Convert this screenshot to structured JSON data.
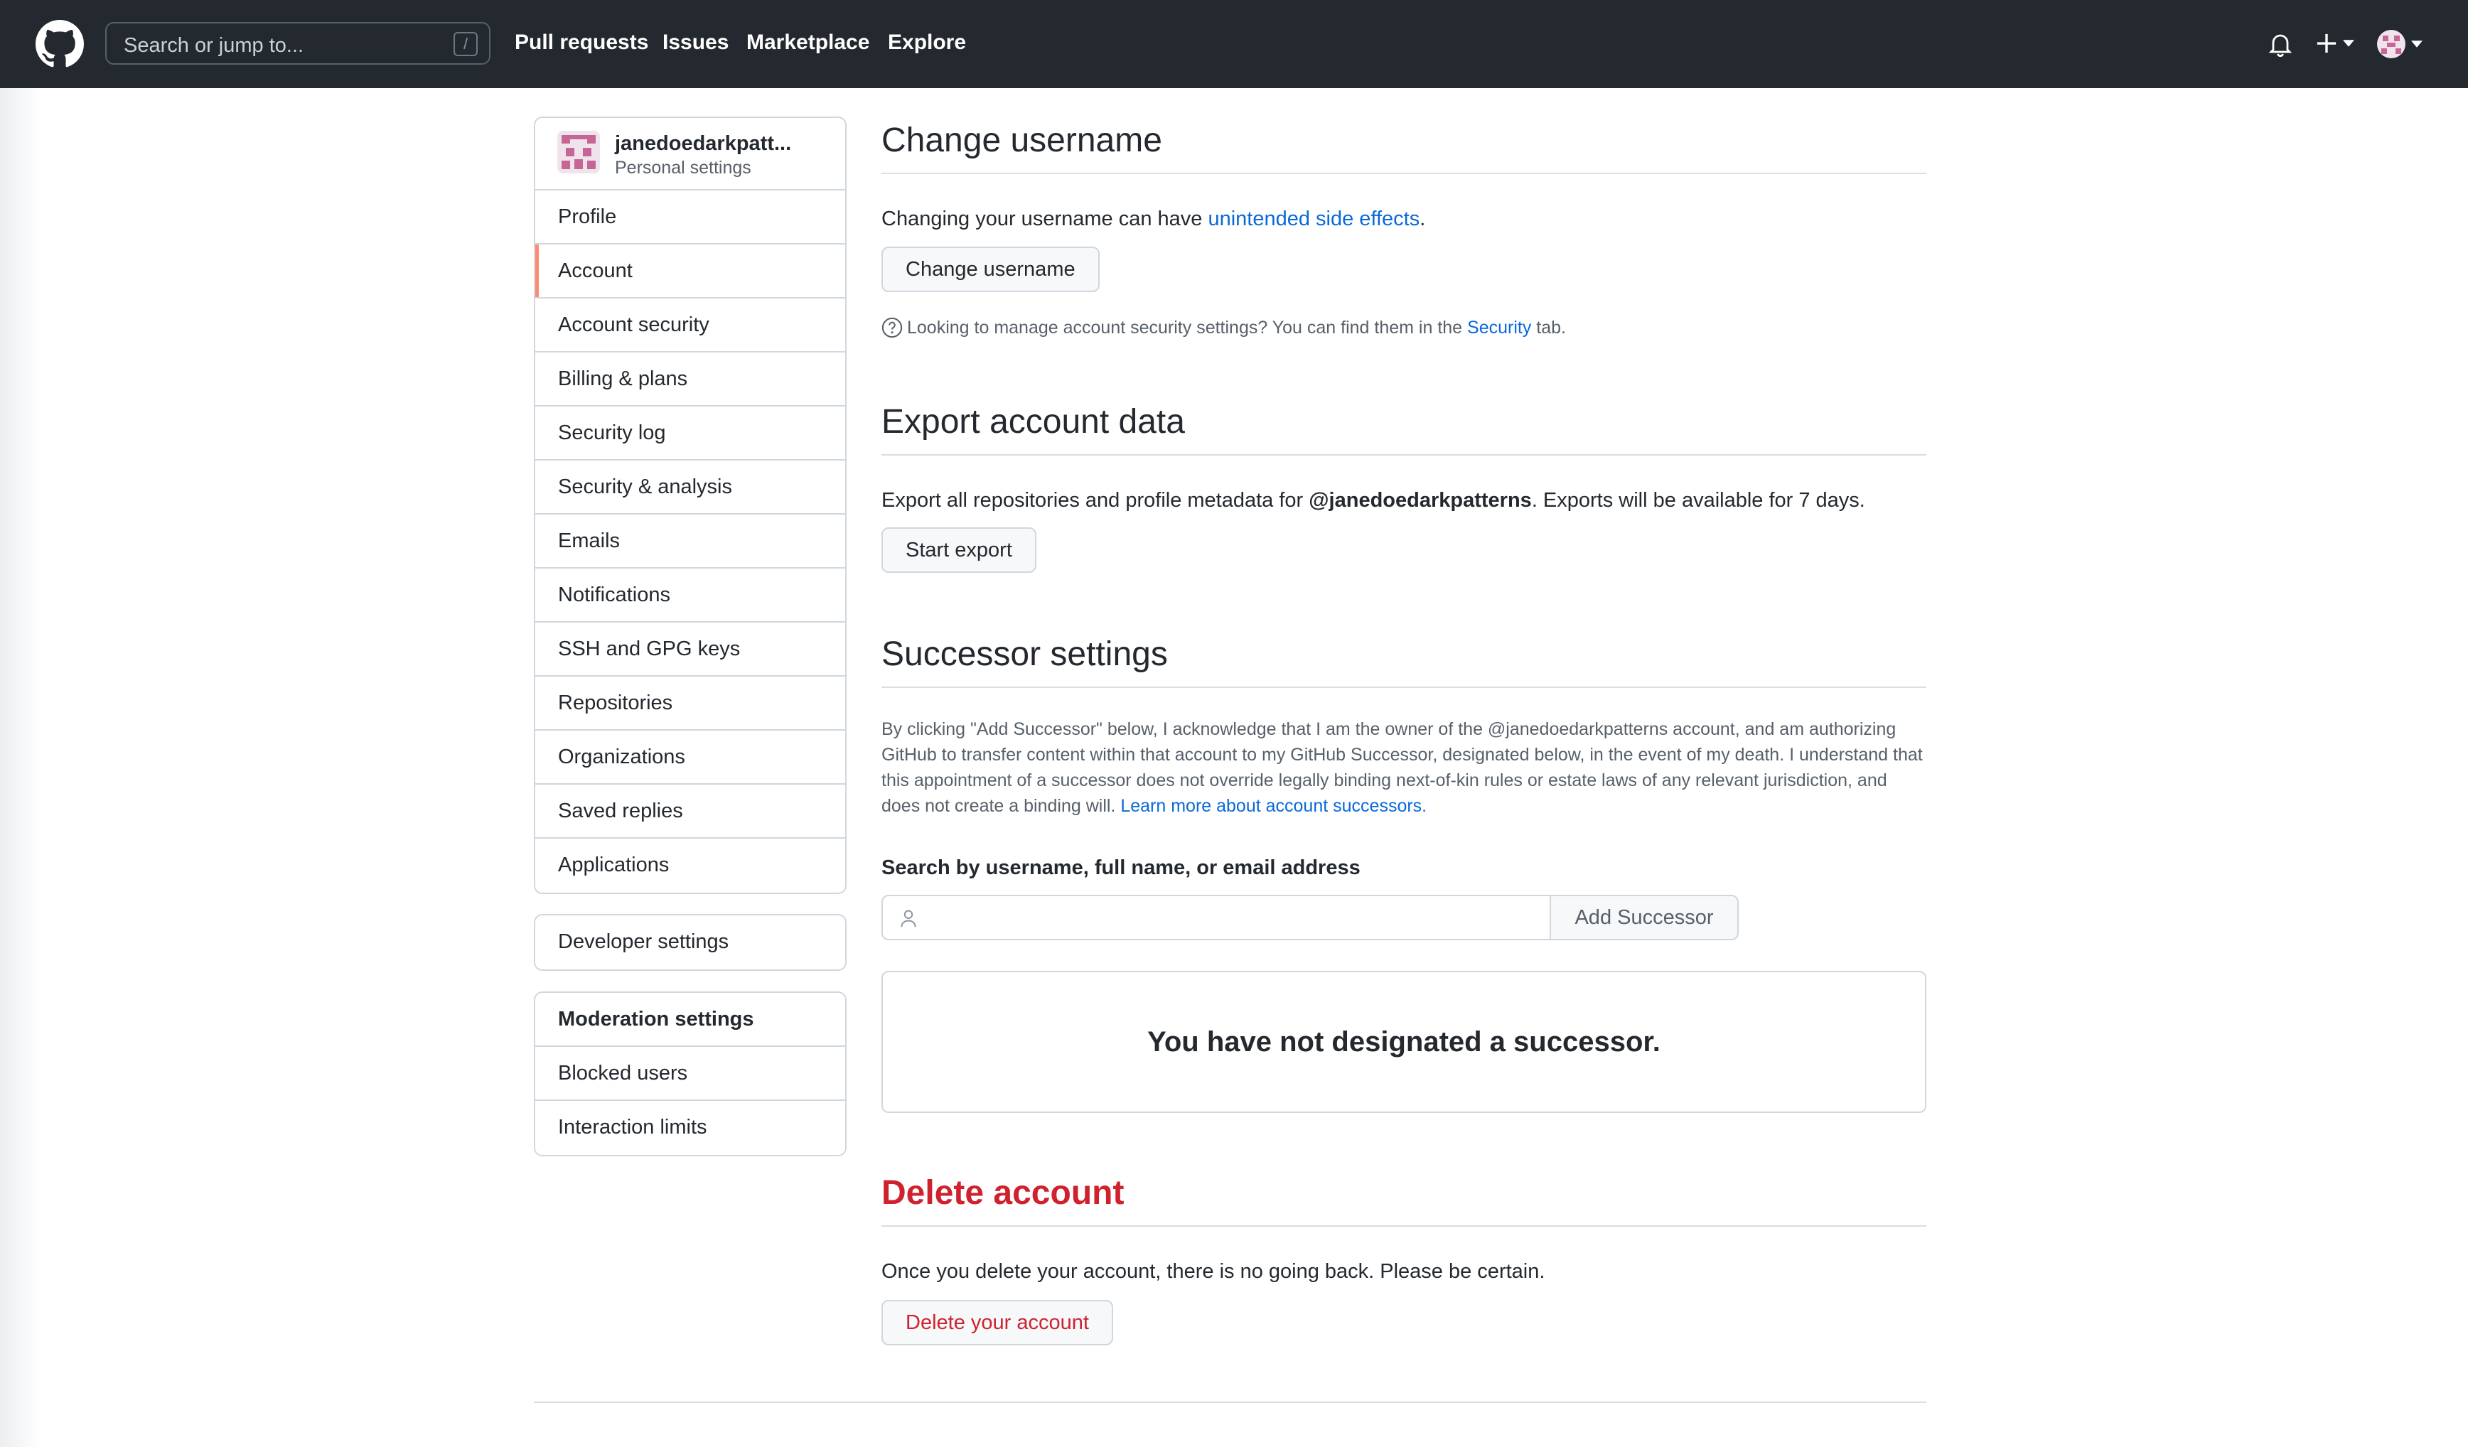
{
  "header": {
    "search_placeholder": "Search or jump to...",
    "search_shortcut": "/",
    "nav": [
      "Pull requests",
      "Issues",
      "Marketplace",
      "Explore"
    ]
  },
  "sidebar": {
    "username": "janedoedarkpatt...",
    "subtitle": "Personal settings",
    "items": [
      "Profile",
      "Account",
      "Account security",
      "Billing & plans",
      "Security log",
      "Security & analysis",
      "Emails",
      "Notifications",
      "SSH and GPG keys",
      "Repositories",
      "Organizations",
      "Saved replies",
      "Applications"
    ],
    "selected": "Account",
    "developer": "Developer settings",
    "moderation": {
      "heading": "Moderation settings",
      "items": [
        "Blocked users",
        "Interaction limits"
      ]
    }
  },
  "change_username": {
    "title": "Change username",
    "text_before": "Changing your username can have ",
    "link": "unintended side effects",
    "text_after": ".",
    "button": "Change username",
    "note_before": "Looking to manage account security settings? You can find them in the ",
    "note_link": "Security",
    "note_after": " tab."
  },
  "export": {
    "title": "Export account data",
    "text_before": "Export all repositories and profile metadata for ",
    "handle": "@janedoedarkpatterns",
    "text_after": ". Exports will be available for 7 days.",
    "button": "Start export"
  },
  "successor": {
    "title": "Successor settings",
    "paragraph": "By clicking \"Add Successor\" below, I acknowledge that I am the owner of the @janedoedarkpatterns account, and am authorizing GitHub to transfer content within that account to my GitHub Successor, designated below, in the event of my death. I understand that this appointment of a successor does not override legally binding next-of-kin rules or estate laws of any relevant jurisdiction, and does not create a binding will. ",
    "learn_more": "Learn more about account successors.",
    "search_label": "Search by username, full name, or email address",
    "input_value": "",
    "button": "Add Successor",
    "empty": "You have not designated a successor."
  },
  "delete": {
    "title": "Delete account",
    "text": "Once you delete your account, there is no going back. Please be certain.",
    "button": "Delete your account"
  },
  "colors": {
    "header_bg": "#24292f",
    "link": "#0969da",
    "danger": "#cf222e",
    "selected_marker": "#fd8c73"
  }
}
